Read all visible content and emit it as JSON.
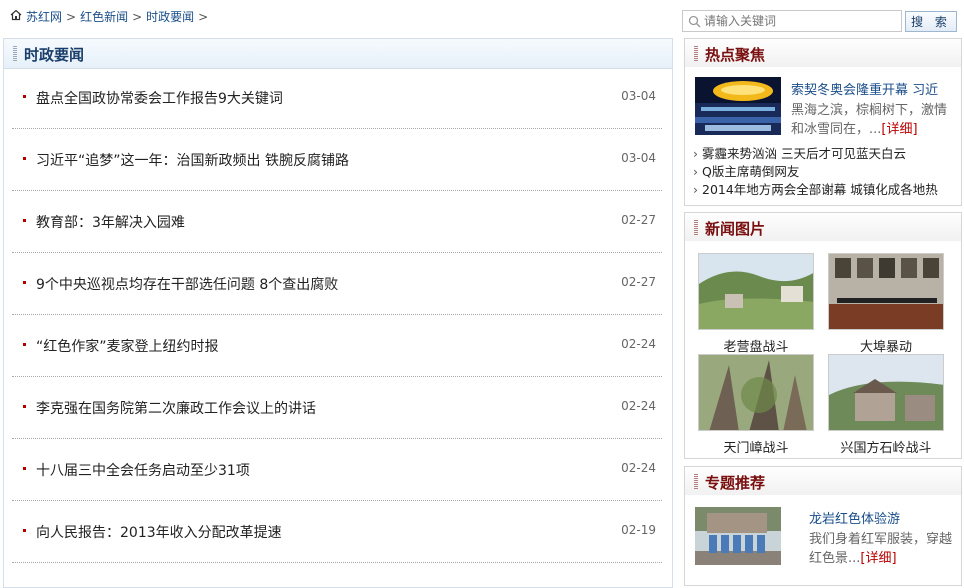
{
  "breadcrumb": {
    "items": [
      "苏红网",
      "红色新闻",
      "时政要闻"
    ],
    "sep": ">"
  },
  "search": {
    "placeholder": "请输入关键词",
    "button": "搜 索"
  },
  "main": {
    "title": "时政要闻",
    "news": [
      {
        "title": "盘点全国政协常委会工作报告9大关键词",
        "date": "03-04"
      },
      {
        "title": "习近平“追梦”这一年：治国新政频出 铁腕反腐铺路",
        "date": "03-04"
      },
      {
        "title": "教育部：3年解决入园难",
        "date": "02-27"
      },
      {
        "title": "9个中央巡视点均存在干部选任问题 8个查出腐败",
        "date": "02-27"
      },
      {
        "title": "“红色作家”麦家登上纽约时报",
        "date": "02-24"
      },
      {
        "title": "李克强在国务院第二次廉政工作会议上的讲话",
        "date": "02-24"
      },
      {
        "title": "十八届三中全会任务启动至少31项",
        "date": "02-24"
      },
      {
        "title": "向人民报告：2013年收入分配改革提速",
        "date": "02-19"
      }
    ]
  },
  "hot": {
    "title": "热点聚焦",
    "feature": {
      "title": "索契冬奥会隆重开幕 习近",
      "summary": "黑海之滨，棕榈树下，激情和冰雪同在，...",
      "more": "[详细]"
    },
    "bullet": "›",
    "list": [
      "雾霾来势汹汹 三天后才可见蓝天白云",
      "Q版主席萌倒网友",
      "2014年地方两会全部谢幕 城镇化成各地热"
    ]
  },
  "pictures": {
    "title": "新闻图片",
    "items": [
      "老营盘战斗",
      "大埠暴动",
      "天门嶂战斗",
      "兴国方石岭战斗"
    ]
  },
  "topic": {
    "title": "专题推荐",
    "feature": {
      "title": "龙岩红色体验游",
      "summary": "我们身着红军服装，穿越红色景...",
      "more": "[详细]"
    }
  }
}
